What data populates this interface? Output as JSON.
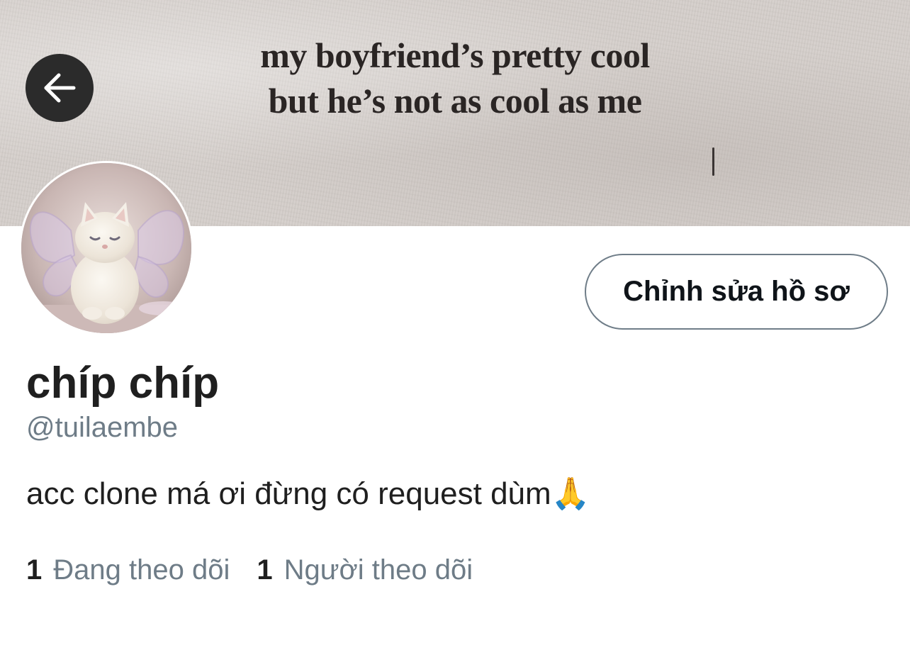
{
  "banner": {
    "quote_line_1": "my boyfriend’s pretty cool",
    "quote_line_2": "but he’s not as cool as me"
  },
  "header": {
    "back_icon": "arrow-left-icon"
  },
  "profile": {
    "avatar_subject": "white-cat-with-fairy-wings",
    "edit_button_label": "Chỉnh sửa hồ sơ",
    "display_name": "chíp chíp",
    "handle": "@tuilaembe",
    "bio": "acc clone má ơi đừng có request dùm🙏",
    "following_count": "1",
    "following_label": "Đang theo dõi",
    "followers_count": "1",
    "followers_label": "Người theo dõi"
  },
  "colors": {
    "text_primary": "#1f1f1f",
    "text_secondary": "#6e7c87",
    "button_border": "#6f7d88",
    "back_button_bg": "#2b2b2b",
    "banner_bg": "#d6d0cc"
  }
}
